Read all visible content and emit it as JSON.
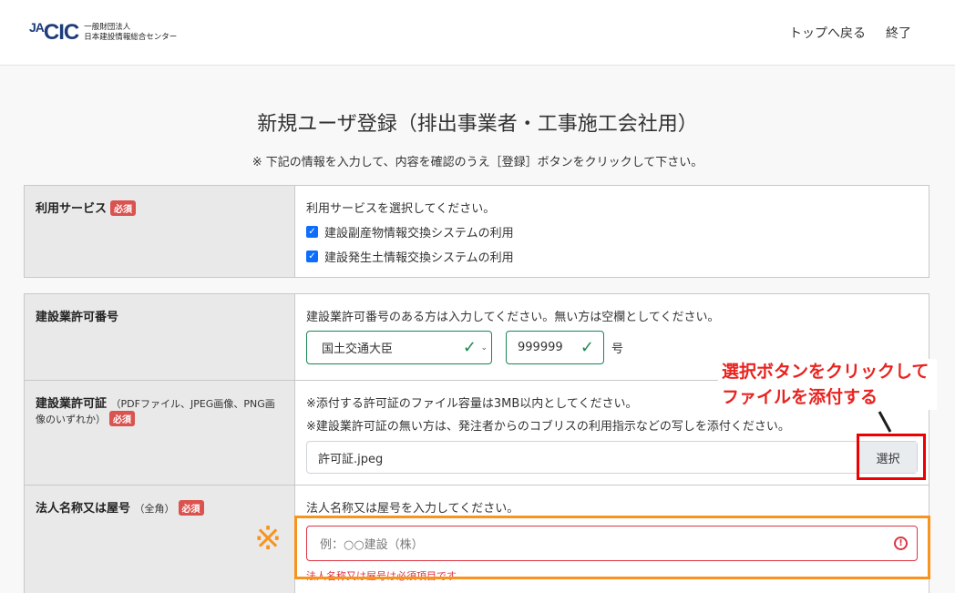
{
  "header": {
    "logo_mark_prefix": "JA",
    "logo_mark": "CIC",
    "org_line1": "一般財団法人",
    "org_line2": "日本建設情報総合センター",
    "nav": {
      "top": "トップへ戻る",
      "exit": "終了"
    }
  },
  "page": {
    "title": "新規ユーザ登録（排出事業者・工事施工会社用）",
    "instruction": "※ 下記の情報を入力して、内容を確認のうえ［登録］ボタンをクリックして下さい。"
  },
  "required_badge": "必須",
  "service": {
    "label": "利用サービス",
    "prompt": "利用サービスを選択してください。",
    "options": [
      {
        "label": "建設副産物情報交換システムの利用",
        "checked": true
      },
      {
        "label": "建設発生土情報交換システムの利用",
        "checked": true
      }
    ]
  },
  "license_no": {
    "label": "建設業許可番号",
    "prompt": "建設業許可番号のある方は入力してください。無い方は空欄としてください。",
    "authority": "国土交通大臣",
    "number": "999999",
    "suffix": "号"
  },
  "license_cert": {
    "label": "建設業許可証",
    "hint": "（PDFファイル、JPEG画像、PNG画像のいずれか）",
    "note1": "※添付する許可証のファイル容量は3MB以内としてください。",
    "note2": "※建設業許可証の無い方は、発注者からのコブリスの利用指示などの写しを添付ください。",
    "filename": "許可証.jpeg",
    "select_button": "選択"
  },
  "company": {
    "label": "法人名称又は屋号",
    "hint": "（全角）",
    "prompt": "法人名称又は屋号を入力してください。",
    "placeholder": "例：○○建設（株）",
    "error": "法人名称又は屋号は必須項目です"
  },
  "annotations": {
    "callout_line1": "選択ボタンをクリックして",
    "callout_line2": "ファイルを添付する",
    "mark": "※"
  },
  "colors": {
    "ok": "#198754",
    "error": "#dc3545",
    "annotation_red": "#e00000",
    "annotation_orange": "#f7931e"
  }
}
